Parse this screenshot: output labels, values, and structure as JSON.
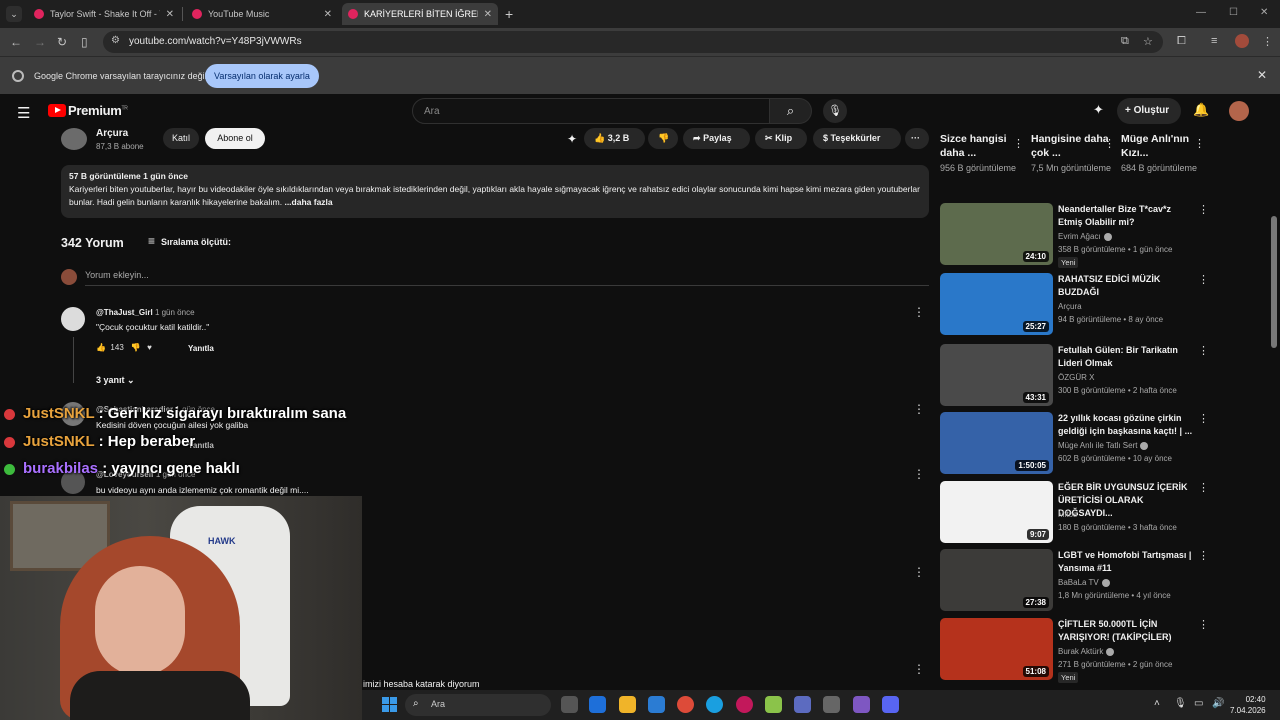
{
  "browser": {
    "tabs": [
      {
        "title": "Taylor Swift - Shake It Off - YouTube"
      },
      {
        "title": "YouTube Music"
      },
      {
        "title": "KARİYERLERİ BİTEN İĞRENÇ YOUTUBERLAR"
      }
    ],
    "url": "youtube.com/watch?v=Y48P3jVWWRs",
    "banner": {
      "message": "Google Chrome varsayılan tarayıcınız değil",
      "button": "Varsayılan olarak ayarla"
    }
  },
  "youtube": {
    "brand": "Premium",
    "brand_sup": "TR",
    "search_placeholder": "Ara",
    "create_label": "Oluştur"
  },
  "video": {
    "channel_name": "Arçura",
    "channel_subs": "87,3 B abone",
    "join_label": "Katıl",
    "subscribe_label": "Abone ol",
    "likes": "3,2 B",
    "share_label": "Paylaş",
    "clip_label": "Klip",
    "thanks_label": "Teşekkürler",
    "description": {
      "meta": "57 B görüntüleme  1 gün önce",
      "text": "Kariyerleri biten youtuberlar, hayır bu videodakiler öyle sıkıldıklarından veya bırakmak istediklerinden değil, yaptıkları akla hayale sığmayacak iğrenç ve rahatsız edici olaylar sonucunda kimi hapse kimi mezara giden youtuberlar bunlar. Hadi gelin bunların karanlık hikayelerine bakalım.",
      "more": " ...daha fazla"
    }
  },
  "comments": {
    "count": "342 Yorum",
    "sort_label": "Sıralama ölçütü:",
    "add_placeholder": "Yorum ekleyin...",
    "reply_label": "Yanıtla",
    "items": [
      {
        "user": "@ThaJust_Girl",
        "time": "1 gün önce",
        "text": "\"Çocuk çocuktur katil katildir..\"",
        "likes": "143",
        "replies": "3 yanıt"
      },
      {
        "user": "@Sebastianbaradier",
        "time": "1 gün önce",
        "text": "Kedisini döven çocuğun ailesi yok galiba",
        "likes": "",
        "replies": ""
      },
      {
        "user": "@Loveyourself",
        "time": "1 gün önce",
        "text": "bu videoyu aynı anda izlememiz çok romantik değil mi....",
        "likes": "",
        "replies": ""
      }
    ],
    "bottom_text": "imizi hesaba katarak diyorum"
  },
  "chat": [
    {
      "user": "JustSNKL",
      "message": " : Geri kız sigarayı bıraktıralım sana",
      "color": "#e8a33d",
      "badge": "#d9383c"
    },
    {
      "user": "JustSNKL",
      "message": " : Hep beraber",
      "color": "#e8a33d",
      "badge": "#d9383c"
    },
    {
      "user": "burakbilas",
      "message": " : yayıncı gene haklı",
      "color": "#a970ff",
      "badge": "#3dbb3d"
    }
  ],
  "sidebar": {
    "shelf": [
      {
        "title": "Sizce hangisi daha ...",
        "views": "956 B görüntüleme"
      },
      {
        "title": "Hangisine daha çok ...",
        "views": "7,5 Mn görüntüleme"
      },
      {
        "title": "Müge Anlı'nın Kızı...",
        "views": "684 B görüntüleme"
      }
    ],
    "recommendations": [
      {
        "title": "Neandertaller Bize T*cav*z Etmiş Olabilir mi?",
        "channel": "Evrim Ağacı",
        "stats": "358 B görüntüleme • 1 gün önce",
        "duration": "24:10",
        "badge": "Yeni",
        "thumb_color": "#5d6b4d",
        "verified": true
      },
      {
        "title": "RAHATSIZ EDİCİ MÜZİK BUZDAĞI",
        "channel": "Arçura",
        "stats": "94 B görüntüleme • 8 ay önce",
        "duration": "25:27",
        "badge": "",
        "thumb_color": "#2a78c9",
        "verified": false
      },
      {
        "title": "Fetullah Gülen: Bir Tarikatın Lideri Olmak",
        "channel": "ÖZGÜR X",
        "stats": "300 B görüntüleme • 2 hafta önce",
        "duration": "43:31",
        "badge": "",
        "thumb_color": "#4a4a4a",
        "verified": false
      },
      {
        "title": "22 yıllık kocası gözüne çirkin geldiği için başkasına kaçtı! | ...",
        "channel": "Müge Anlı ile Tatlı Sert",
        "stats": "602 B görüntüleme • 10 ay önce",
        "duration": "1:50:05",
        "badge": "",
        "thumb_color": "#3562a8",
        "verified": true
      },
      {
        "title": "EĞER BİR UYGUNSUZ İÇERİK ÜRETİCİSİ OLARAK DOĞSAYDI...",
        "channel": "Mitos",
        "stats": "180 B görüntüleme • 3 hafta önce",
        "duration": "9:07",
        "badge": "",
        "thumb_color": "#f2f2f2",
        "verified": false
      },
      {
        "title": "LGBT ve Homofobi Tartışması | Yansıma #11",
        "channel": "BaBaLa TV",
        "stats": "1,8 Mn görüntüleme • 4 yıl önce",
        "duration": "27:38",
        "badge": "",
        "thumb_color": "#3c3b39",
        "verified": true
      },
      {
        "title": "ÇİFTLER 50.000TL İÇİN YARIŞIYOR! (TAKİPÇİLER)",
        "channel": "Burak Aktürk",
        "stats": "271 B görüntüleme • 2 gün önce",
        "duration": "51:08",
        "badge": "Yeni",
        "thumb_color": "#b5321c",
        "verified": true
      }
    ]
  },
  "taskbar": {
    "search_placeholder": "Ara",
    "time": "02:40",
    "date": "7.04.2026"
  }
}
